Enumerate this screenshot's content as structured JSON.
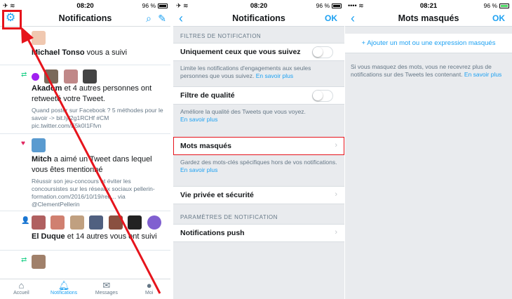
{
  "p1": {
    "status": {
      "time": "08:20",
      "battery": "96 %"
    },
    "nav": {
      "title": "Notifications"
    },
    "items": [
      {
        "head_name": "Michael Tonso",
        "head_rest": " vous a suivi",
        "sub": ""
      },
      {
        "head_name": "Akadom",
        "head_rest": " et 4 autres personnes ont retweeté votre Tweet.",
        "sub": "Quand poster sur Facebook ? 5 méthodes pour le savoir -> bit.ly/2g1RCHf #CM pic.twitter.com/E5k0I1Ffvn"
      },
      {
        "head_name": "Mitch",
        "head_rest": " a aimé un Tweet dans lequel vous êtes mentionné",
        "sub": "Réussir son jeu-concours et éviter les concoursistes sur les réseaux sociaux pellerin-formation.com/2016/10/19/reu... via @ClementPellerin"
      },
      {
        "head_name": "El Duque",
        "head_rest": " et 14 autres vous ont suivi",
        "sub": ""
      },
      {
        "head_name": "",
        "head_rest": "",
        "sub": ""
      }
    ],
    "tabs": [
      {
        "label": "Accueil",
        "icon": "home-icon"
      },
      {
        "label": "Notifications",
        "icon": "bell-icon"
      },
      {
        "label": "Messages",
        "icon": "mail-icon"
      },
      {
        "label": "Moi",
        "icon": "person-icon"
      }
    ]
  },
  "p2": {
    "status": {
      "time": "08:20",
      "battery": "96 %"
    },
    "nav": {
      "title": "Notifications",
      "ok": "OK"
    },
    "section1": "FILTRES DE NOTIFICATION",
    "row1": "Uniquement ceux que vous suivez",
    "hint1": "Limite les notifications d'engagements aux seules personnes que vous suivez.",
    "row2": "Filtre de qualité",
    "hint2": "Améliore la qualité des Tweets que vous voyez.",
    "row3": "Mots masqués",
    "hint3": "Gardez des mots-clés spécifiques hors de vos notifications.",
    "row4": "Vie privée et sécurité",
    "section2": "PARAMÈTRES DE NOTIFICATION",
    "row5": "Notifications push",
    "learn_more": "En savoir plus"
  },
  "p3": {
    "status": {
      "time": "08:21",
      "battery": "96 %"
    },
    "nav": {
      "title": "Mots masqués",
      "ok": "OK"
    },
    "add": "+ Ajouter un mot ou une expression masqués",
    "hint": "Si vous masquez des mots, vous ne recevrez plus de notifications sur des Tweets les contenant.",
    "learn_more": "En savoir plus"
  },
  "colors": {
    "accent": "#1da1f2",
    "highlight": "#e6141c",
    "retweet": "#19cf86",
    "like": "#e0245e"
  }
}
